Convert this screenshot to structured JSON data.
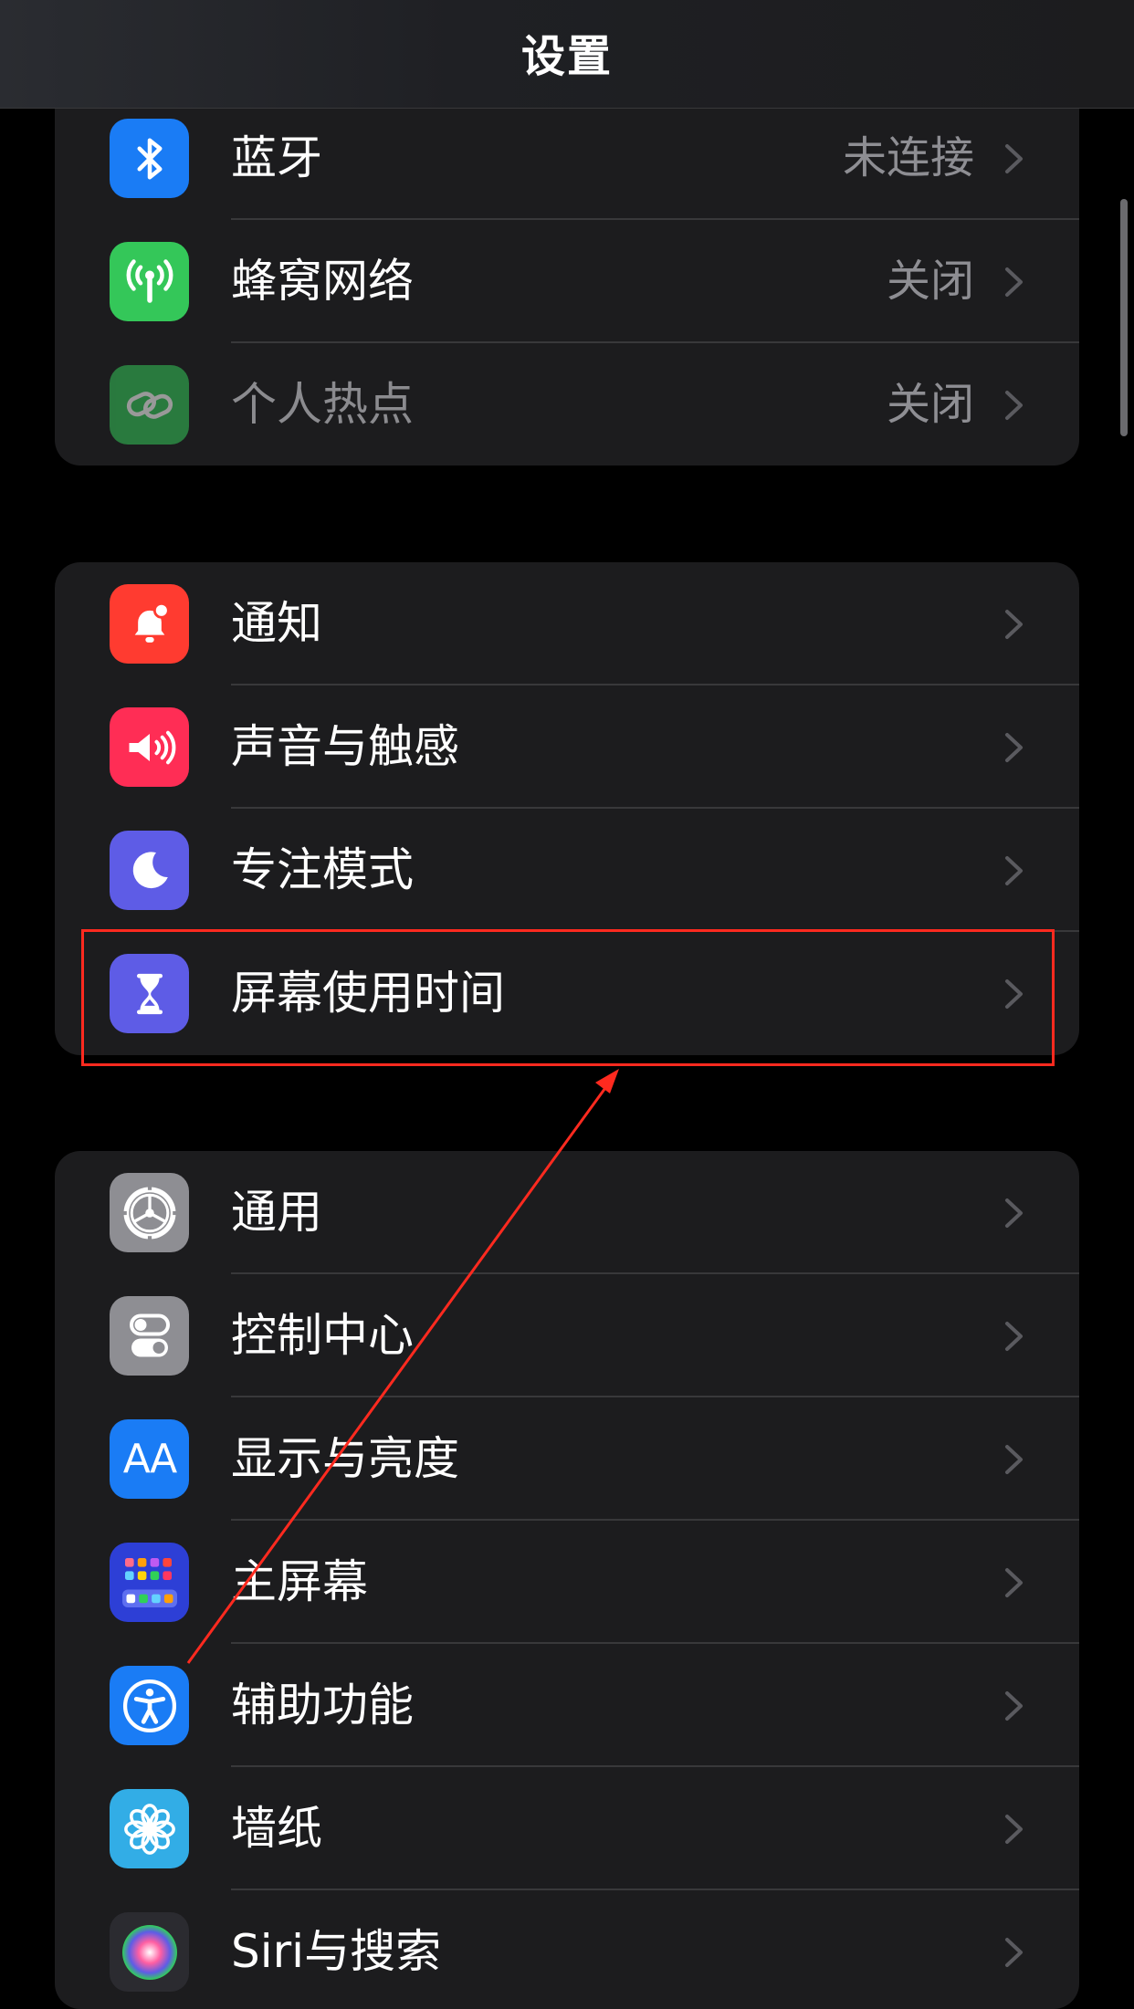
{
  "header": {
    "title": "设置"
  },
  "groups": [
    {
      "rows": [
        {
          "label": "蓝牙",
          "value": "未连接",
          "icon": "bluetooth-icon",
          "color": "#1a7cf5"
        },
        {
          "label": "蜂窝网络",
          "value": "关闭",
          "icon": "cellular-antenna-icon",
          "color": "#34c759"
        },
        {
          "label": "个人热点",
          "value": "关闭",
          "icon": "hotspot-link-icon",
          "color": "#34c759",
          "disabled": true
        }
      ]
    },
    {
      "rows": [
        {
          "label": "通知",
          "icon": "notification-bell-icon",
          "color": "#ff3b30"
        },
        {
          "label": "声音与触感",
          "icon": "speaker-icon",
          "color": "#ff2d55"
        },
        {
          "label": "专注模式",
          "icon": "moon-icon",
          "color": "#5e5ce6"
        },
        {
          "label": "屏幕使用时间",
          "icon": "hourglass-icon",
          "color": "#5e5ce6"
        }
      ]
    },
    {
      "rows": [
        {
          "label": "通用",
          "icon": "gear-icon",
          "color": "#8e8e93"
        },
        {
          "label": "控制中心",
          "icon": "toggles-icon",
          "color": "#8e8e93"
        },
        {
          "label": "显示与亮度",
          "icon": "text-size-icon",
          "icon_text": "AA",
          "color": "#1a7cf5"
        },
        {
          "label": "主屏幕",
          "icon": "home-screen-grid-icon",
          "color": "#2d3fd6"
        },
        {
          "label": "辅助功能",
          "icon": "accessibility-icon",
          "color": "#1a7cf5"
        },
        {
          "label": "墙纸",
          "icon": "flower-icon",
          "color": "#32ade6"
        },
        {
          "label": "Siri与搜索",
          "icon": "siri-icon",
          "color": "#2b2b30"
        }
      ]
    }
  ],
  "annotation": {
    "highlight_color": "#ff2a1f",
    "highlighted_item": "屏幕使用时间"
  }
}
